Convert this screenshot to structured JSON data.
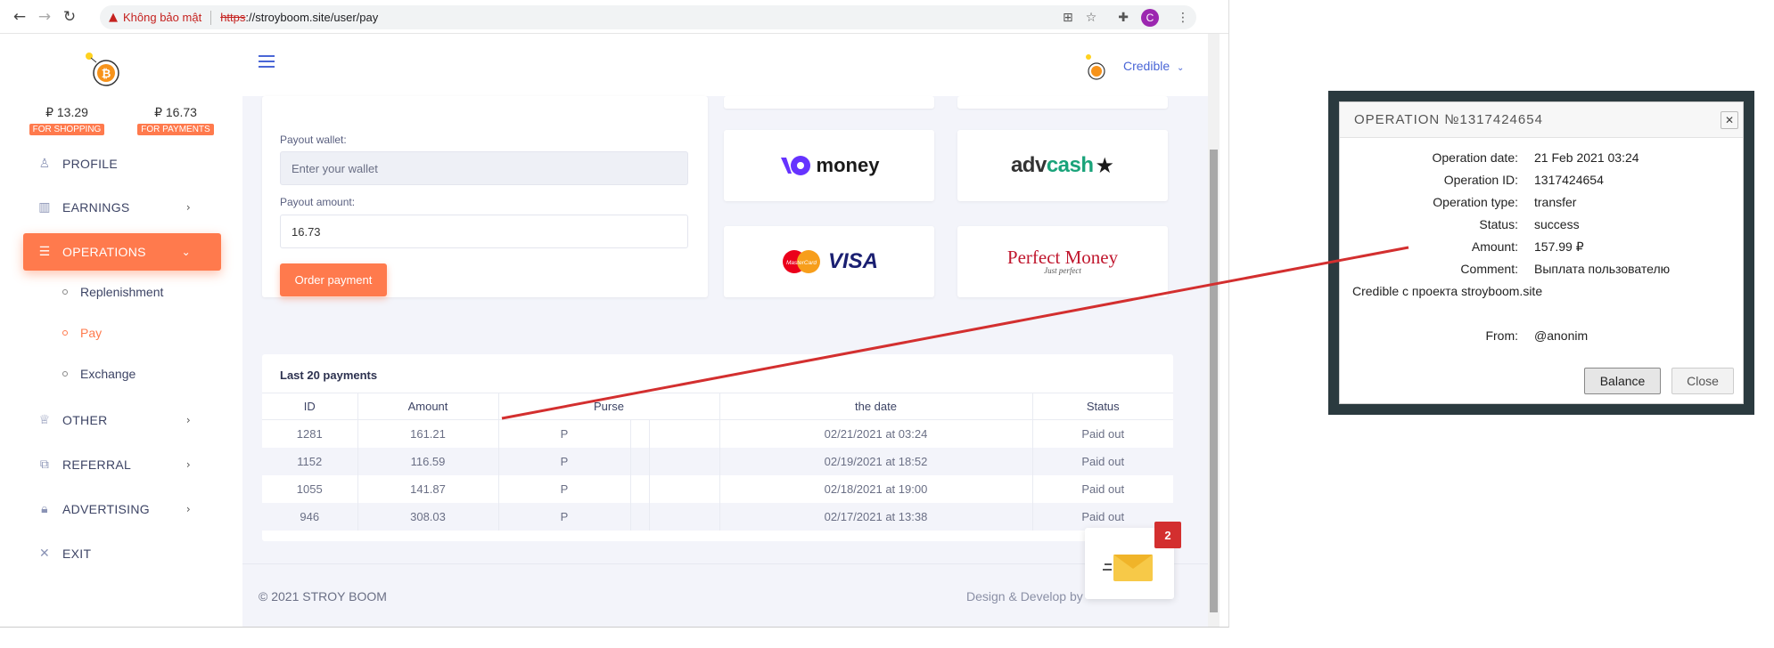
{
  "browser": {
    "security_warning": "Không bảo mật",
    "url_scheme": "https",
    "url_rest": "://stroyboom.site/user/pay",
    "profile_initial": "C"
  },
  "sidebar": {
    "balances": [
      {
        "amount": "₽ 13.29",
        "tag": "FOR SHOPPING"
      },
      {
        "amount": "₽ 16.73",
        "tag": "FOR PAYMENTS"
      }
    ],
    "items": [
      {
        "label": "PROFILE",
        "icon": "user-icon"
      },
      {
        "label": "EARNINGS",
        "icon": "chart-icon"
      },
      {
        "label": "OPERATIONS",
        "icon": "database-icon"
      },
      {
        "label": "OTHER",
        "icon": "crown-icon"
      },
      {
        "label": "REFERRAL",
        "icon": "referral-icon"
      },
      {
        "label": "ADVERTISING",
        "icon": "lock-icon"
      },
      {
        "label": "EXIT",
        "icon": "close-icon"
      }
    ],
    "subitems": [
      "Replenishment",
      "Pay",
      "Exchange"
    ]
  },
  "header": {
    "user_name": "Credible"
  },
  "payout_form": {
    "wallet_label": "Payout wallet:",
    "wallet_placeholder": "Enter your wallet",
    "amount_label": "Payout amount:",
    "amount_value": "16.73",
    "order_button": "Order payment"
  },
  "payment_methods": {
    "yoomoney": "money",
    "advcash_prefix": "adv",
    "advcash_cash": "cash",
    "mastercard": "MasterCard",
    "visa": "VISA",
    "perfect_money": "Perfect Money",
    "perfect_money_tagline": "Just perfect"
  },
  "payments_table": {
    "title": "Last 20 payments",
    "columns": [
      "ID",
      "Amount",
      "Purse",
      "the date",
      "Status"
    ],
    "rows": [
      {
        "id": "1281",
        "amount": "161.21",
        "purse": "P",
        "date": "02/21/2021 at 03:24",
        "status": "Paid out"
      },
      {
        "id": "1152",
        "amount": "116.59",
        "purse": "P",
        "date": "02/19/2021 at 18:52",
        "status": "Paid out"
      },
      {
        "id": "1055",
        "amount": "141.87",
        "purse": "P",
        "date": "02/18/2021 at 19:00",
        "status": "Paid out"
      },
      {
        "id": "946",
        "amount": "308.03",
        "purse": "P",
        "date": "02/17/2021 at 13:38",
        "status": "Paid out"
      }
    ]
  },
  "footer": {
    "copyright": "© 2021 STROY BOOM",
    "design": "Design & Develop by"
  },
  "mail_widget": {
    "badge": "2"
  },
  "operation_dialog": {
    "title": "OPERATION №1317424654",
    "fields": [
      {
        "key": "Operation date:",
        "value": "21 Feb 2021 03:24"
      },
      {
        "key": "Operation ID:",
        "value": "1317424654"
      },
      {
        "key": "Operation type:",
        "value": "transfer"
      },
      {
        "key": "Status:",
        "value": "success"
      },
      {
        "key": "Amount:",
        "value": "157.99 ₽"
      },
      {
        "key": "Comment:",
        "value": "Выплата пользователю"
      }
    ],
    "comment_continued": "Credible с проекта stroyboom.site",
    "from_key": "From:",
    "from_value": "@anonim",
    "balance_button": "Balance",
    "close_button": "Close"
  },
  "colors": {
    "accent": "#ff7a4d",
    "primary": "#4a66d6",
    "annotation_line": "#d32f2f",
    "dialog_frame": "#2b3a3f"
  }
}
